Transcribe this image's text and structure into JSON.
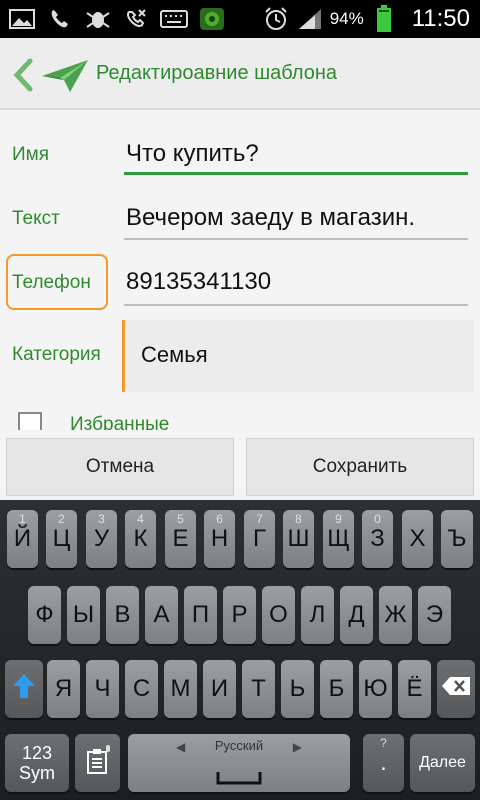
{
  "status_bar": {
    "battery_percent": "94%",
    "time": "11:50"
  },
  "action_bar": {
    "title": "Редактироавние шаблона"
  },
  "form": {
    "name": {
      "label": "Имя",
      "value": "Что купить?"
    },
    "text": {
      "label": "Текст",
      "value": "Вечером заеду в магазин."
    },
    "phone": {
      "label": "Телефон",
      "value": "89135341130"
    },
    "category": {
      "label": "Категория",
      "value": "Семья"
    },
    "favorites": {
      "label": "Избранные",
      "checked": false
    }
  },
  "buttons": {
    "cancel": "Отмена",
    "save": "Сохранить"
  },
  "keyboard": {
    "row1": [
      {
        "label": "Й",
        "hint": "1"
      },
      {
        "label": "Ц",
        "hint": "2"
      },
      {
        "label": "У",
        "hint": "3"
      },
      {
        "label": "К",
        "hint": "4"
      },
      {
        "label": "Е",
        "hint": "5"
      },
      {
        "label": "Н",
        "hint": "6"
      },
      {
        "label": "Г",
        "hint": "7"
      },
      {
        "label": "Ш",
        "hint": "8"
      },
      {
        "label": "Щ",
        "hint": "9"
      },
      {
        "label": "З",
        "hint": "0"
      },
      {
        "label": "Х",
        "hint": ""
      },
      {
        "label": "Ъ",
        "hint": ""
      }
    ],
    "row2": [
      "Ф",
      "Ы",
      "В",
      "А",
      "П",
      "Р",
      "О",
      "Л",
      "Д",
      "Ж",
      "Э"
    ],
    "row3": [
      "Я",
      "Ч",
      "С",
      "М",
      "И",
      "Т",
      "Ь",
      "Б",
      "Ю",
      "Ё"
    ],
    "sym_top": "123",
    "sym_bottom": "Sym",
    "language": "Русский",
    "period": ".",
    "period_hint": "?",
    "enter": "Далее"
  }
}
